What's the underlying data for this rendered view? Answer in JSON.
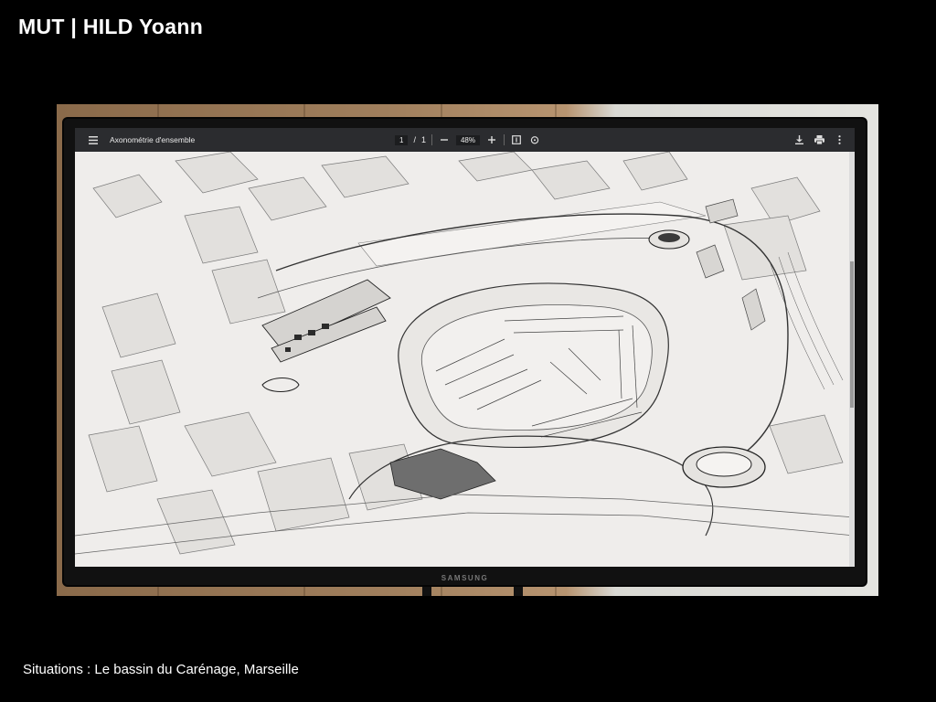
{
  "slide": {
    "title": "MUT | HILD Yoann",
    "caption": "Situations : Le bassin du Carénage, Marseille"
  },
  "monitor": {
    "brand": "SAMSUNG"
  },
  "viewer": {
    "document_title": "Axonométrie d'ensemble",
    "page_current": "1",
    "page_separator": "/",
    "page_total": "1",
    "zoom": "48%",
    "icons": {
      "menu": "menu-icon",
      "zoom_out": "minus-icon",
      "zoom_in": "plus-icon",
      "fit": "fit-page-icon",
      "rotate": "rotate-icon",
      "download": "download-icon",
      "print": "print-icon",
      "more": "more-vertical-icon"
    }
  }
}
